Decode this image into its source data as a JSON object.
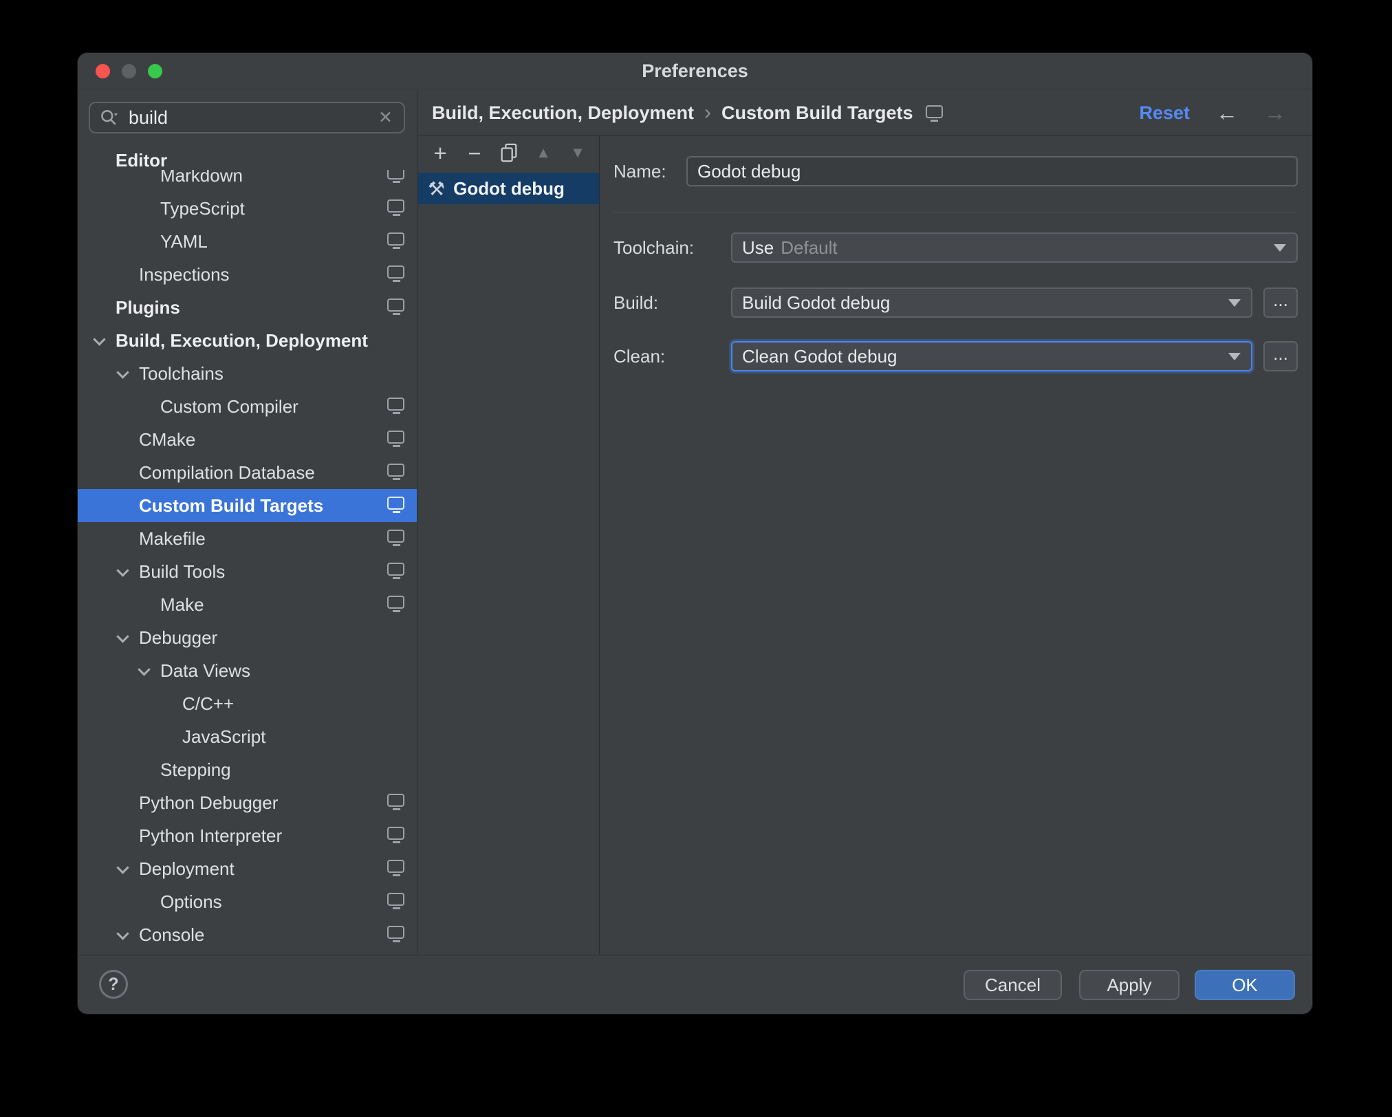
{
  "titlebar": {
    "title": "Preferences"
  },
  "traffic_lights": {
    "close": "#f6564f",
    "minimize": "#5d6064",
    "zoom": "#36c94a"
  },
  "sidebar": {
    "search_value": "build",
    "clear_icon": "✕",
    "sticky_header": "Editor",
    "tree": [
      {
        "label": "Markdown",
        "indent": 3,
        "icon": true
      },
      {
        "label": "TypeScript",
        "indent": 3,
        "icon": true
      },
      {
        "label": "YAML",
        "indent": 3,
        "icon": true
      },
      {
        "label": "Inspections",
        "indent": 2,
        "icon": true
      },
      {
        "label": "Plugins",
        "indent": 1,
        "bold": true,
        "icon": true
      },
      {
        "label": "Build, Execution, Deployment",
        "indent": 1,
        "bold": true,
        "chevron": true
      },
      {
        "label": "Toolchains",
        "indent": 2,
        "chevron": true
      },
      {
        "label": "Custom Compiler",
        "indent": 3,
        "icon": true
      },
      {
        "label": "CMake",
        "indent": 2,
        "icon": true
      },
      {
        "label": "Compilation Database",
        "indent": 2,
        "icon": true
      },
      {
        "label": "Custom Build Targets",
        "indent": 2,
        "icon": true,
        "selected": true
      },
      {
        "label": "Makefile",
        "indent": 2,
        "icon": true
      },
      {
        "label": "Build Tools",
        "indent": 2,
        "chevron": true,
        "icon": true
      },
      {
        "label": "Make",
        "indent": 3,
        "icon": true
      },
      {
        "label": "Debugger",
        "indent": 2,
        "chevron": true
      },
      {
        "label": "Data Views",
        "indent": 3,
        "chevron": true
      },
      {
        "label": "C/C++",
        "indent": 4
      },
      {
        "label": "JavaScript",
        "indent": 4
      },
      {
        "label": "Stepping",
        "indent": 3
      },
      {
        "label": "Python Debugger",
        "indent": 2,
        "icon": true
      },
      {
        "label": "Python Interpreter",
        "indent": 2,
        "icon": true
      },
      {
        "label": "Deployment",
        "indent": 2,
        "chevron": true,
        "icon": true
      },
      {
        "label": "Options",
        "indent": 3,
        "icon": true
      },
      {
        "label": "Console",
        "indent": 2,
        "chevron": true,
        "icon": true
      }
    ]
  },
  "header": {
    "breadcrumb_parent": "Build, Execution, Deployment",
    "breadcrumb_separator": "›",
    "breadcrumb_current": "Custom Build Targets",
    "reset": "Reset",
    "back_icon": "←",
    "forward_icon": "→"
  },
  "target_toolbar": [
    {
      "name": "add",
      "glyph": "+",
      "enabled": true
    },
    {
      "name": "remove",
      "glyph": "−",
      "enabled": true
    },
    {
      "name": "copy",
      "glyph": "copy",
      "enabled": true
    },
    {
      "name": "move-up",
      "glyph": "▲",
      "enabled": false
    },
    {
      "name": "move-down",
      "glyph": "▼",
      "enabled": false
    }
  ],
  "targets": [
    {
      "label": "Godot debug",
      "icon": "hammer-wrench",
      "glyph": "⚒",
      "selected": true
    }
  ],
  "form": {
    "name_label": "Name:",
    "name_value": "Godot debug",
    "toolchain_label": "Toolchain:",
    "toolchain_use": "Use",
    "toolchain_default": "Default",
    "build_label": "Build:",
    "build_value": "Build Godot debug",
    "build_more": "...",
    "clean_label": "Clean:",
    "clean_value": "Clean Godot debug",
    "clean_more": "..."
  },
  "footer": {
    "help": "?",
    "cancel": "Cancel",
    "apply": "Apply",
    "ok": "OK"
  },
  "colors": {
    "window_bg": "#3d4043",
    "tree_selection_blue": "#3a74d9",
    "list_selection_navy": "#153c64",
    "link_blue": "#548af7",
    "ok_button_blue": "#3c70b8",
    "focus_ring_blue": "#4c86ee"
  }
}
